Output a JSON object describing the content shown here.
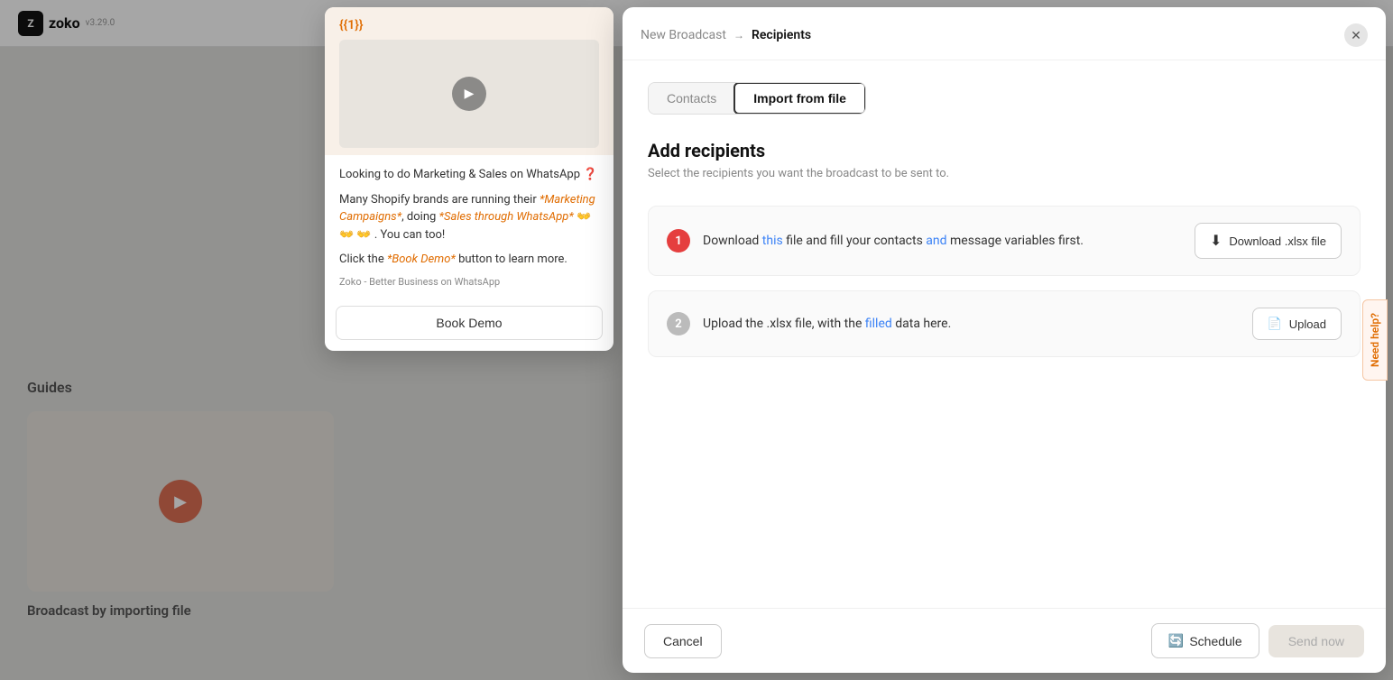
{
  "app": {
    "logo_text": "zoko",
    "version": "v3.29.0"
  },
  "background": {
    "guides_label": "Guides",
    "guide_card_alt": "Broadcast tutorial video",
    "broadcast_by_importing": "Broadcast by importing file"
  },
  "message_card": {
    "template_tag": "{{1}}",
    "line1": "Looking to do Marketing & Sales on WhatsApp ",
    "line1_emoji": "❓",
    "line2_prefix": "Many Shopify brands are running their ",
    "line2_bold1": "*Marketing Campaigns*",
    "line2_mid": ", doing ",
    "line2_bold2": "*Sales through WhatsApp*",
    "line2_emojis": " 👐 👐 👐 . You can too!",
    "line3": "Click the *Book Demo* button to learn more.",
    "company": "Zoko - Better Business on WhatsApp",
    "book_demo_label": "Book Demo"
  },
  "dialog": {
    "breadcrumb_parent": "New Broadcast",
    "breadcrumb_current": "Recipients",
    "tabs": [
      {
        "id": "contacts",
        "label": "Contacts",
        "active": false
      },
      {
        "id": "import",
        "label": "Import from file",
        "active": true
      }
    ],
    "section_title": "Add recipients",
    "section_subtitle": "Select the recipients you want the broadcast to be sent to.",
    "steps": [
      {
        "number": "1",
        "style": "red",
        "text_before": "Download ",
        "text_link": "this",
        "text_after": " file and fill your contacts ",
        "text_link2": "and",
        "text_after2": " message variables first.",
        "btn_label": "Download .xlsx file",
        "btn_icon": "⬇"
      },
      {
        "number": "2",
        "style": "gray",
        "text_before": "Upload the .xlsx file, with the ",
        "text_link": "filled",
        "text_after": " data here.",
        "btn_label": "Upload",
        "btn_icon": "📄"
      }
    ],
    "footer": {
      "cancel_label": "Cancel",
      "schedule_label": "Schedule",
      "schedule_icon": "🔄",
      "send_now_label": "Send now"
    },
    "need_help_label": "Need help?"
  }
}
